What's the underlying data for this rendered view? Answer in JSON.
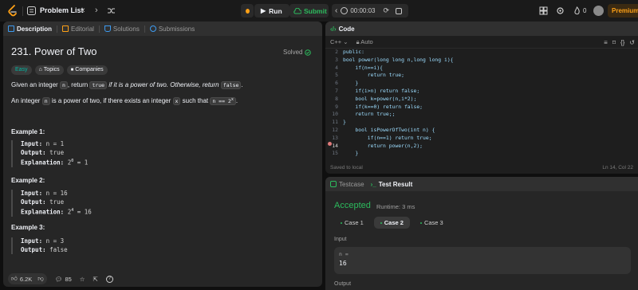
{
  "topbar": {
    "title": "Problem List",
    "run_label": "Run",
    "submit_label": "Submit",
    "timer": "00:00:03",
    "notification_count": "0",
    "premium_label": "Premium"
  },
  "left_tabs": [
    {
      "label": "Description"
    },
    {
      "label": "Editorial"
    },
    {
      "label": "Solutions"
    },
    {
      "label": "Submissions"
    }
  ],
  "problem": {
    "title": "231. Power of Two",
    "status": "Solved",
    "difficulty": "Easy",
    "topics_label": "Topics",
    "companies_label": "Companies",
    "desc1": {
      "a": "Given an integer",
      "var": "n",
      "b": ", return",
      "true": "true",
      "c": "if it is a power of two. Otherwise, return",
      "false": "false",
      "d": "."
    },
    "desc2": {
      "a": "An integer",
      "var_n": "n",
      "b": "is a power of two, if there exists an integer",
      "var_x": "x",
      "c": "such that",
      "expr": "n == 2",
      "exp": "x",
      "d": "."
    },
    "examples": [
      {
        "title": "Example 1:",
        "input": "n = 1",
        "output": "true",
        "explanation": "2",
        "exp_pow": "0",
        "exp_val": "= 1"
      },
      {
        "title": "Example 2:",
        "input": "n = 16",
        "output": "true",
        "explanation": "2",
        "exp_pow": "4",
        "exp_val": "= 16"
      },
      {
        "title": "Example 3:",
        "input": "n = 3",
        "output": "false"
      }
    ],
    "labels": {
      "input": "Input:",
      "output": "Output:",
      "explanation": "Explanation:"
    }
  },
  "footer": {
    "likes": "6.2K",
    "comments": "85"
  },
  "code_panel": {
    "title": "Code",
    "language": "C++",
    "mode": "Auto",
    "saved_status": "Saved to local",
    "cursor": "Ln 14, Col 22",
    "lines": [
      {
        "n": "2",
        "text": "public:"
      },
      {
        "n": "3",
        "text": "bool power(long long n,long long i){"
      },
      {
        "n": "4",
        "text": "    if(n==i){"
      },
      {
        "n": "5",
        "text": "        return true;"
      },
      {
        "n": "6",
        "text": "    }"
      },
      {
        "n": "7",
        "text": "    if(i>n) return false;"
      },
      {
        "n": "8",
        "text": "    bool k=power(n,i*2);"
      },
      {
        "n": "9",
        "text": "    if(k==0) return false;"
      },
      {
        "n": "10",
        "text": "    return true;;"
      },
      {
        "n": "11",
        "text": "}"
      },
      {
        "n": "12",
        "text": "    bool isPowerOfTwo(int n) {"
      },
      {
        "n": "13",
        "text": "        if(n==1) return true;"
      },
      {
        "n": "14",
        "text": "        return power(n,2);"
      },
      {
        "n": "15",
        "text": "    }"
      }
    ]
  },
  "result_panel": {
    "tabs": [
      {
        "label": "Testcase"
      },
      {
        "label": "Test Result"
      }
    ],
    "verdict": "Accepted",
    "runtime": "Runtime: 3 ms",
    "cases": [
      {
        "label": "Case 1"
      },
      {
        "label": "Case 2"
      },
      {
        "label": "Case 3"
      }
    ],
    "input_label": "Input",
    "var_name": "n =",
    "var_value": "16",
    "output_label": "Output"
  },
  "colors": {
    "accent": "#ffa116",
    "accepted": "#2cbb5d",
    "easy": "#00b8a3"
  }
}
